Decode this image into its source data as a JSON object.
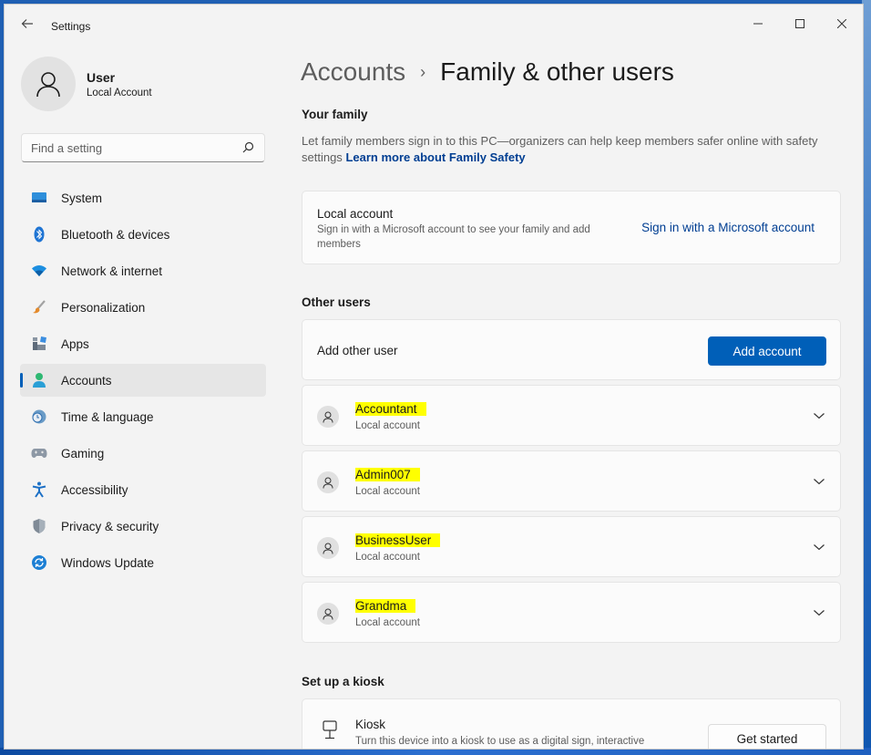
{
  "window": {
    "title": "Settings",
    "back_icon": "back-arrow-icon"
  },
  "profile": {
    "name": "User",
    "account_type": "Local Account"
  },
  "search": {
    "placeholder": "Find a setting"
  },
  "nav": {
    "items": [
      {
        "label": "System",
        "icon": "system-icon"
      },
      {
        "label": "Bluetooth & devices",
        "icon": "bluetooth-icon"
      },
      {
        "label": "Network & internet",
        "icon": "wifi-icon"
      },
      {
        "label": "Personalization",
        "icon": "brush-icon"
      },
      {
        "label": "Apps",
        "icon": "apps-icon"
      },
      {
        "label": "Accounts",
        "icon": "accounts-icon",
        "selected": true
      },
      {
        "label": "Time & language",
        "icon": "clock-globe-icon"
      },
      {
        "label": "Gaming",
        "icon": "gamepad-icon"
      },
      {
        "label": "Accessibility",
        "icon": "accessibility-icon"
      },
      {
        "label": "Privacy & security",
        "icon": "shield-icon"
      },
      {
        "label": "Windows Update",
        "icon": "update-icon"
      }
    ]
  },
  "breadcrumb": {
    "parent": "Accounts",
    "separator": "›",
    "current": "Family & other users"
  },
  "your_family": {
    "heading": "Your family",
    "description": "Let family members sign in to this PC—organizers can help keep members safer online with safety settings",
    "link": "Learn more about Family Safety",
    "card": {
      "title": "Local account",
      "subtitle": "Sign in with a Microsoft account to see your family and add members",
      "action": "Sign in with a Microsoft account"
    }
  },
  "other_users": {
    "heading": "Other users",
    "add_row": {
      "label": "Add other user",
      "button": "Add account"
    },
    "users": [
      {
        "name": "Accountant",
        "type": "Local account"
      },
      {
        "name": "Admin007",
        "type": "Local account"
      },
      {
        "name": "BusinessUser",
        "type": "Local account"
      },
      {
        "name": "Grandma",
        "type": "Local account"
      }
    ]
  },
  "kiosk": {
    "heading": "Set up a kiosk",
    "title": "Kiosk",
    "subtitle": "Turn this device into a kiosk to use as a digital sign, interactive display, or other things",
    "button": "Get started"
  },
  "colors": {
    "accent": "#005fb8",
    "link": "#003e92",
    "highlight": "#ffff00",
    "window_bg": "#f3f3f3",
    "card_bg": "#fbfbfb"
  }
}
